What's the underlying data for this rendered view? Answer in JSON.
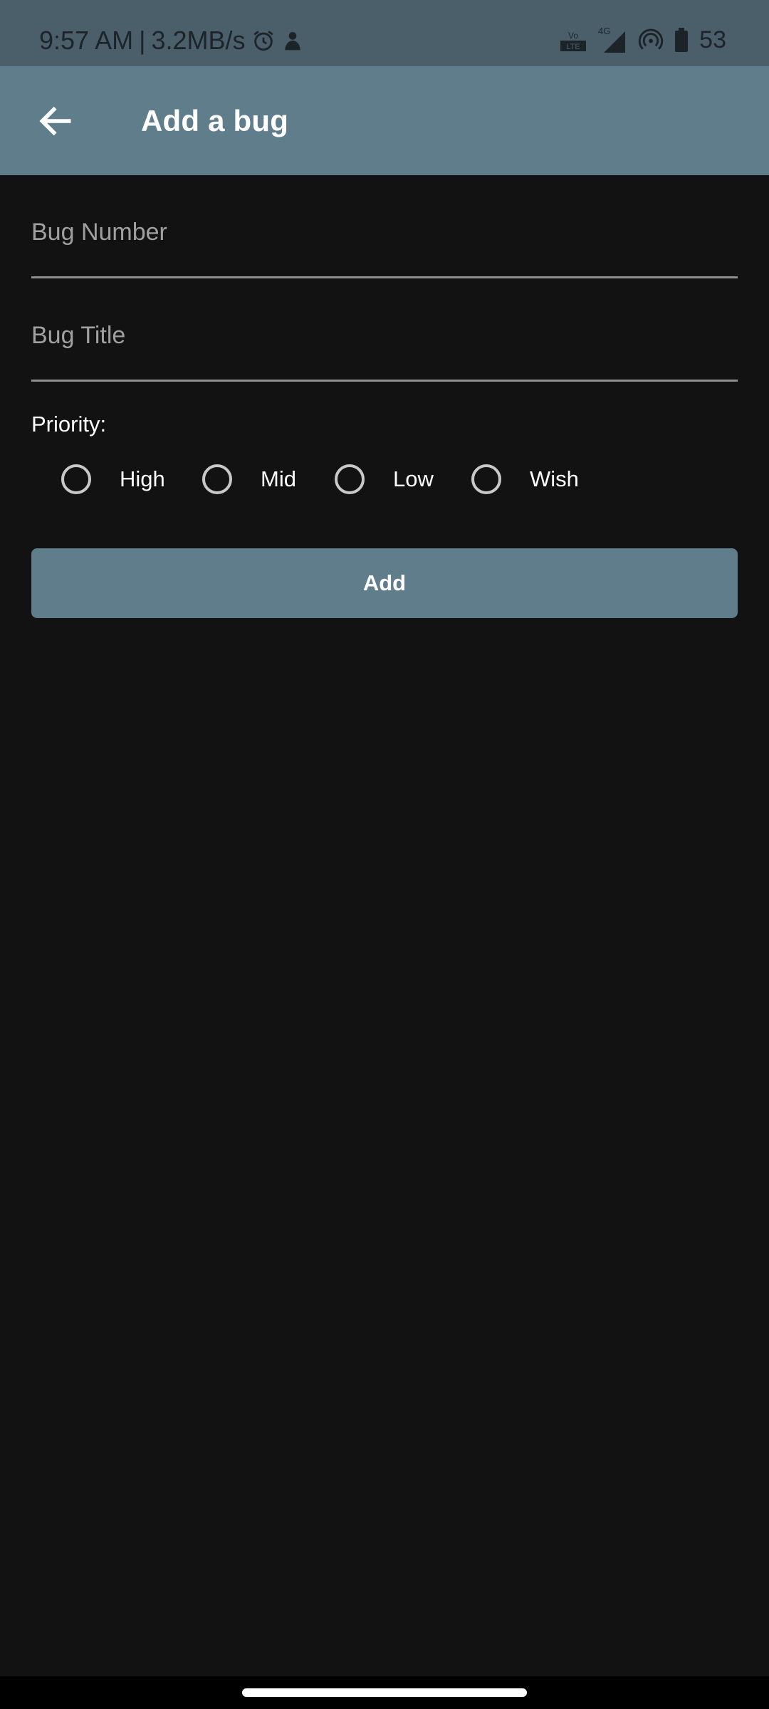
{
  "status_bar": {
    "time": "9:57 AM",
    "separator": "|",
    "speed": "3.2MB/s",
    "network": "4G",
    "battery": "53",
    "icons": [
      "alarm-icon",
      "notification-app-icon",
      "volte-icon",
      "signal-icon",
      "hotspot-icon",
      "battery-icon"
    ]
  },
  "app_bar": {
    "title": "Add a bug",
    "back_icon": "arrow-back-icon",
    "color": "#607d8b"
  },
  "form": {
    "bug_number_placeholder": "Bug Number",
    "bug_number_value": "",
    "bug_title_placeholder": "Bug Title",
    "bug_title_value": "",
    "priority_label": "Priority:",
    "priority_options": [
      {
        "label": "High",
        "selected": false
      },
      {
        "label": "Mid",
        "selected": false
      },
      {
        "label": "Low",
        "selected": false
      },
      {
        "label": "Wish",
        "selected": false
      }
    ],
    "add_label": "Add"
  },
  "colors": {
    "background": "#121212",
    "accent": "#607d8b",
    "status_bar": "#4b5f6a"
  }
}
